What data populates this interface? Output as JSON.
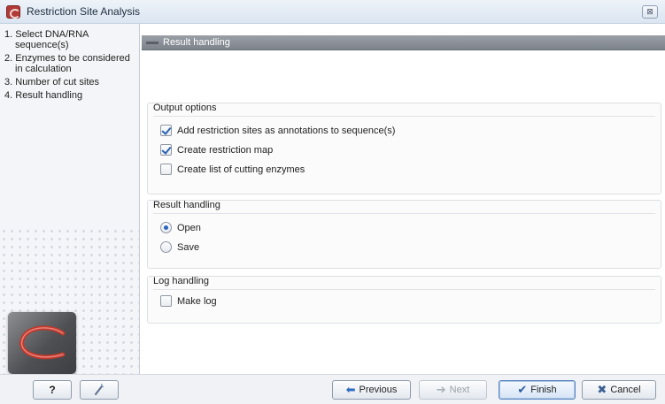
{
  "window": {
    "title": "Restriction Site Analysis",
    "close_glyph": "⊠"
  },
  "steps": {
    "items": [
      {
        "number": "1.",
        "line1": "Select DNA/RNA",
        "line2": "sequence(s)"
      },
      {
        "number": "2.",
        "line1": "Enzymes to be considered",
        "line2": "in calculation"
      },
      {
        "number": "3.",
        "line1": "Number of cut sites",
        "line2": ""
      },
      {
        "number": "4.",
        "line1": "Result handling",
        "line2": ""
      }
    ]
  },
  "main": {
    "header_title": "Result handling",
    "output_options": {
      "title": "Output options",
      "options": [
        {
          "label": "Add restriction sites as annotations to sequence(s)",
          "checked": true
        },
        {
          "label": "Create restriction map",
          "checked": true
        },
        {
          "label": "Create list of cutting enzymes",
          "checked": false
        }
      ]
    },
    "result_handling": {
      "title": "Result handling",
      "options": [
        {
          "label": "Open",
          "selected": true
        },
        {
          "label": "Save",
          "selected": false
        }
      ]
    },
    "log_handling": {
      "title": "Log handling",
      "options": [
        {
          "label": "Make log",
          "checked": false
        }
      ]
    }
  },
  "buttons": {
    "help": {
      "label": "?"
    },
    "restore": {
      "icon": "wand-icon"
    },
    "previous": {
      "label": "Previous",
      "icon": "arrow-left-icon",
      "enabled": true
    },
    "next": {
      "label": "Next",
      "icon": "arrow-right-icon",
      "enabled": false
    },
    "finish": {
      "label": "Finish",
      "icon": "checkmark-icon",
      "enabled": true
    },
    "cancel": {
      "label": "Cancel",
      "icon": "x-icon",
      "enabled": true
    }
  },
  "colors": {
    "header_bar": "#8a9098",
    "accent_blue": "#2a62b6",
    "logo_red": "#c0392b"
  }
}
